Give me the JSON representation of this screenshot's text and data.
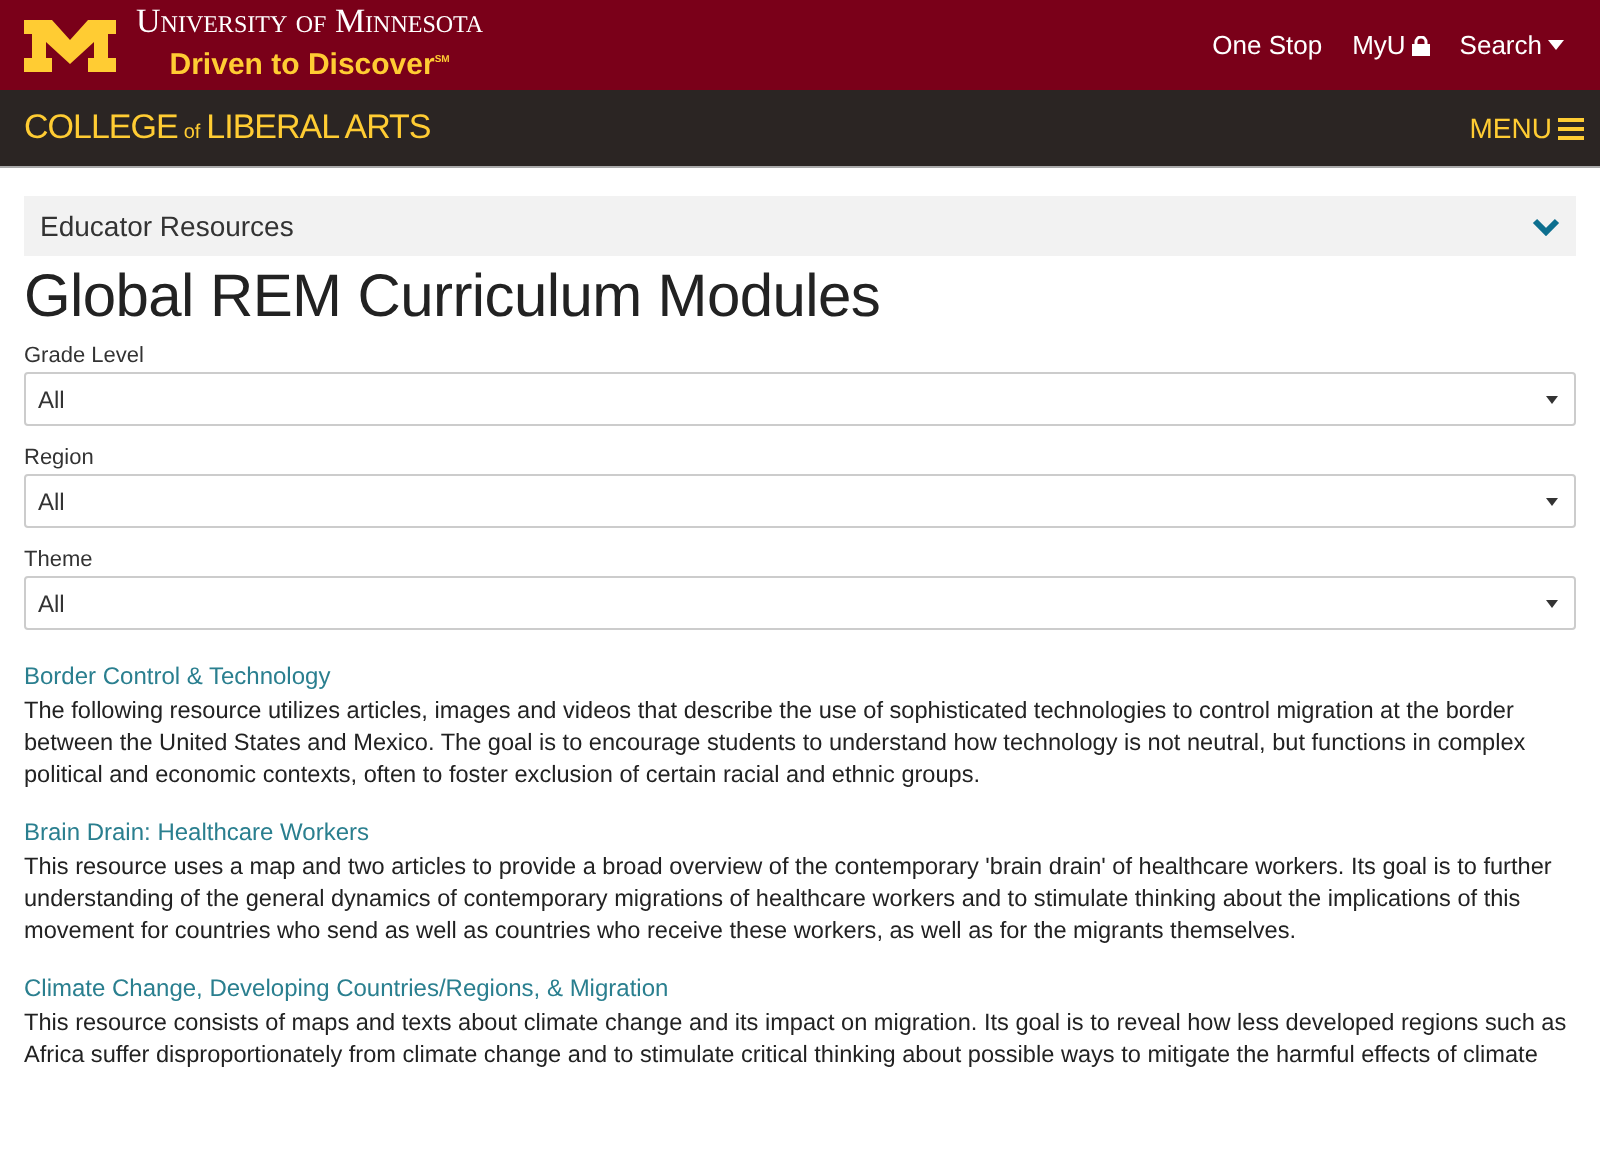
{
  "header": {
    "university": "University of Minnesota",
    "tagline": "Driven to Discover$^{SM}$",
    "links": [
      {
        "label": "One Stop",
        "kind": "plain"
      },
      {
        "label": "MyU",
        "kind": "lock"
      },
      {
        "label": "Search",
        "kind": "caret"
      }
    ]
  },
  "college_bar": {
    "college": "COLLEGE",
    "of": "of",
    "arts": "LIBERAL ARTS",
    "menu": "MENU"
  },
  "accordion": {
    "label": "Educator Resources",
    "expanded": false
  },
  "title": "Global REM Curriculum Modules",
  "filters": [
    {
      "label": "Grade Level",
      "value": "All"
    },
    {
      "label": "Region",
      "value": "All"
    },
    {
      "label": "Theme",
      "value": "All"
    }
  ],
  "resources": [
    {
      "title": "Border Control & Technology",
      "description": "The following resource utilizes articles, images and videos that describe the use of sophisticated technologies to control migration at the border between the United States and Mexico. The goal is to encourage students to understand how technology is not neutral, but functions in complex political and economic contexts, often to foster exclusion of certain racial and ethnic groups."
    },
    {
      "title": "Brain Drain: Healthcare Workers",
      "description": "This resource uses a map and two articles to provide a broad overview of the contemporary 'brain drain' of healthcare workers. Its goal is to further understanding of the general dynamics of contemporary migrations of healthcare workers and to stimulate thinking about the implications of this movement for countries who send as well as countries who receive these workers, as well as for the migrants themselves."
    },
    {
      "title": "Climate Change, Developing Countries/Regions, & Migration",
      "description": "This resource consists of maps and texts about climate change and its impact on migration. Its goal is to reveal how less developed regions such as Africa suffer disproportionately from climate change and to stimulate critical thinking about possible ways to mitigate the harmful effects of climate"
    }
  ]
}
